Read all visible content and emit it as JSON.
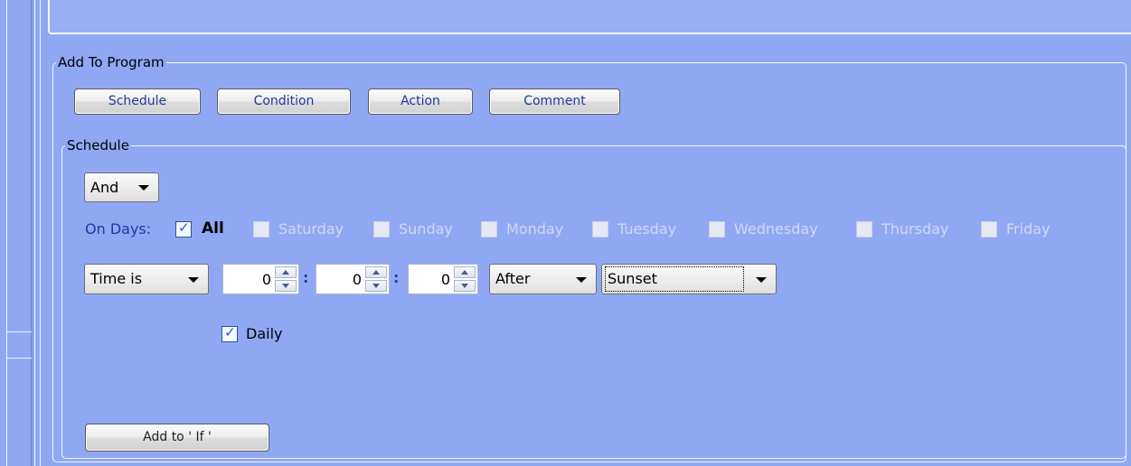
{
  "add_to_program": {
    "title": "Add To Program",
    "buttons": [
      "Schedule",
      "Condition",
      "Action",
      "Comment"
    ]
  },
  "schedule": {
    "title": "Schedule",
    "logic_select": "And",
    "on_days_label": "On Days:",
    "all_label": "All",
    "all_checked": true,
    "days": [
      {
        "label": "Saturday",
        "checked": false
      },
      {
        "label": "Sunday",
        "checked": false
      },
      {
        "label": "Monday",
        "checked": false
      },
      {
        "label": "Tuesday",
        "checked": false
      },
      {
        "label": "Wednesday",
        "checked": false
      },
      {
        "label": "Thursday",
        "checked": false
      },
      {
        "label": "Friday",
        "checked": false
      }
    ],
    "time_type_select": "Time is",
    "hours": "0",
    "minutes": "0",
    "seconds": "0",
    "separator": ":",
    "relation_select": "After",
    "event_select": "Sunset",
    "daily_label": "Daily",
    "daily_checked": true,
    "add_if_button": "Add to ' If '"
  },
  "colors": {
    "background": "#90A8F4",
    "link_blue": "#1E3A9E"
  }
}
